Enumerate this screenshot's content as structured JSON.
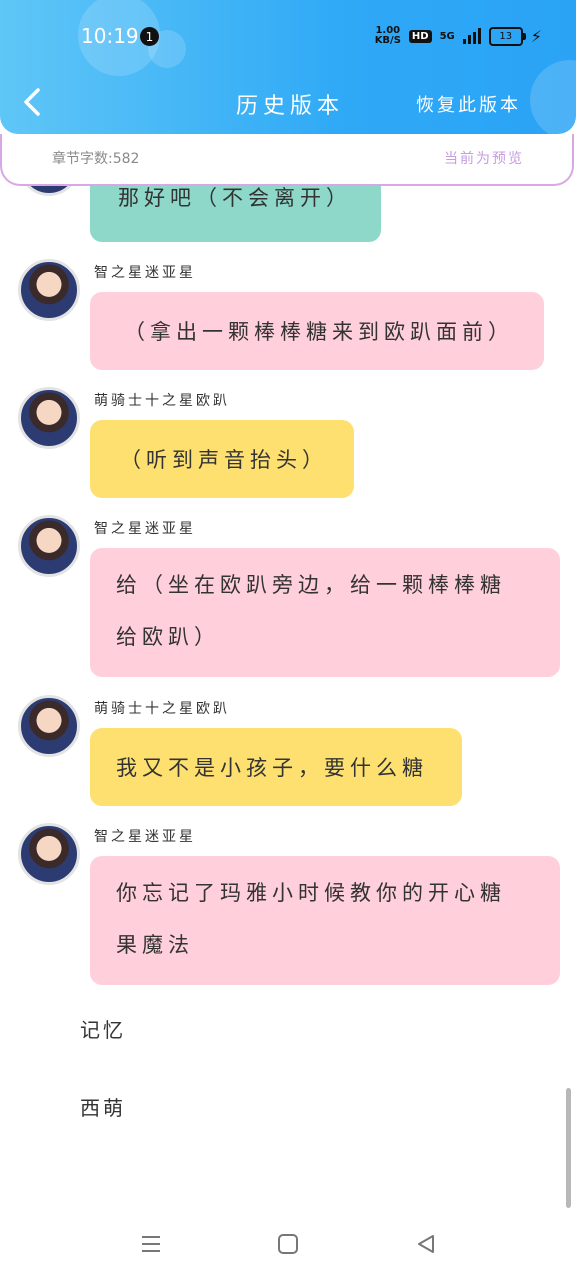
{
  "status_bar": {
    "time": "10:19",
    "notification_count": "1",
    "net_speed_value": "1.00",
    "net_speed_unit": "KB/S",
    "hd_label": "HD",
    "network": "5G",
    "battery": "13"
  },
  "header": {
    "back_icon": "chevron-left-icon",
    "title": "历史版本",
    "restore_label": "恢复此版本"
  },
  "info_bar": {
    "word_count": "章节字数:582",
    "preview_label": "当前为预览"
  },
  "messages": [
    {
      "type": "bubble",
      "color": "teal",
      "text": "那好吧（不会离开）"
    },
    {
      "type": "bubble",
      "color": "pink",
      "name": "智之星迷亚星",
      "text": "（拿出一颗棒棒糖来到欧趴面前）"
    },
    {
      "type": "bubble",
      "color": "yellow",
      "name": "萌骑士十之星欧趴",
      "text": "（听到声音抬头）"
    },
    {
      "type": "bubble",
      "color": "pink",
      "name": "智之星迷亚星",
      "text_line1": "给（坐在欧趴旁边，给一颗棒棒糖",
      "text_line2": "给欧趴）"
    },
    {
      "type": "bubble",
      "color": "yellow",
      "name": "萌骑士十之星欧趴",
      "text": "我又不是小孩子，要什么糖"
    },
    {
      "type": "bubble",
      "color": "pink",
      "name": "智之星迷亚星",
      "text_line1": "你忘记了玛雅小时候教你的开心糖",
      "text_line2": "果魔法"
    }
  ],
  "plain_text": [
    "记忆",
    "西萌"
  ],
  "colors": {
    "header_start": "#5fc6f7",
    "header_end": "#2aa3f5",
    "teal_bubble": "#8dd8c9",
    "pink_bubble": "#ffd0dc",
    "yellow_bubble": "#fde070",
    "preview_text": "#c89be0"
  },
  "nav_bar": {
    "menu_icon": "menu-icon",
    "home_icon": "square-home-icon",
    "back_icon": "triangle-back-icon"
  }
}
